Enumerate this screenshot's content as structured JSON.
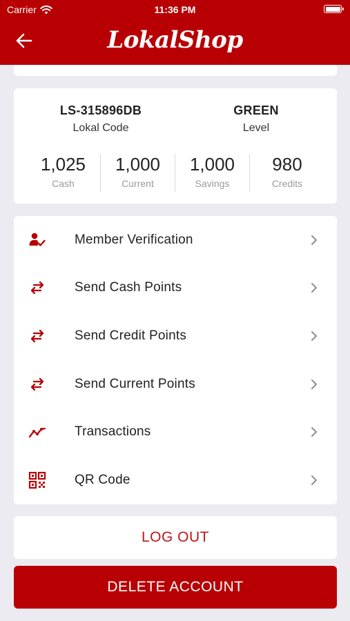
{
  "status_bar": {
    "carrier": "Carrier",
    "time": "11:36 PM"
  },
  "header": {
    "app_title": "LokalShop"
  },
  "profile": {
    "code": {
      "value": "LS-315896DB",
      "label": "Lokal Code"
    },
    "level": {
      "value": "GREEN",
      "label": "Level"
    }
  },
  "stats": [
    {
      "value": "1,025",
      "label": "Cash"
    },
    {
      "value": "1,000",
      "label": "Current"
    },
    {
      "value": "1,000",
      "label": "Savings"
    },
    {
      "value": "980",
      "label": "Credits"
    }
  ],
  "menu": [
    {
      "label": "Member Verification",
      "icon": "user-check-icon"
    },
    {
      "label": "Send Cash Points",
      "icon": "transfer-arrows-icon"
    },
    {
      "label": "Send Credit Points",
      "icon": "transfer-arrows-icon"
    },
    {
      "label": "Send Current Points",
      "icon": "transfer-arrows-icon"
    },
    {
      "label": "Transactions",
      "icon": "trend-line-icon"
    },
    {
      "label": "QR Code",
      "icon": "qr-code-icon"
    }
  ],
  "actions": {
    "logout_label": "LOG OUT",
    "delete_label": "DELETE ACCOUNT"
  },
  "colors": {
    "brand": "#b80004",
    "background": "#ecebf1",
    "danger_text": "#c0151a"
  }
}
